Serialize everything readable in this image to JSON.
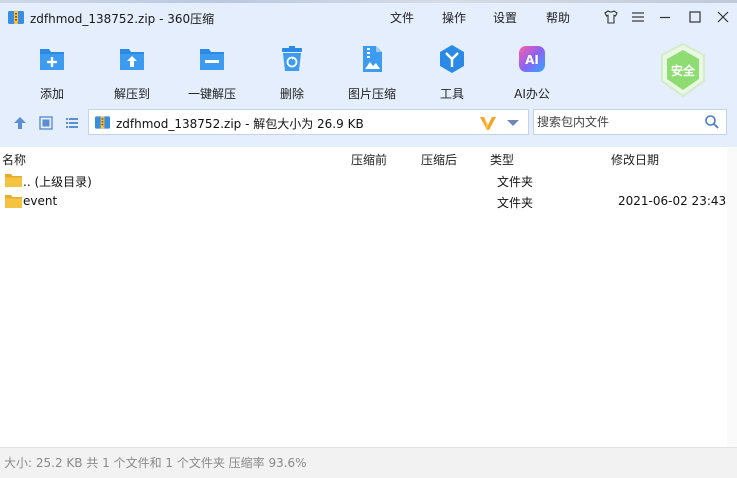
{
  "window": {
    "title": "zdfhmod_138752.zip - 360压缩",
    "menus": [
      "文件",
      "操作",
      "设置",
      "帮助"
    ]
  },
  "toolbar": {
    "items": [
      {
        "label": "添加",
        "icon": "add-icon"
      },
      {
        "label": "解压到",
        "icon": "extract-to-icon"
      },
      {
        "label": "一键解压",
        "icon": "one-click-extract-icon"
      },
      {
        "label": "删除",
        "icon": "delete-icon"
      },
      {
        "label": "图片压缩",
        "icon": "image-compress-icon"
      },
      {
        "label": "工具",
        "icon": "tools-icon"
      },
      {
        "label": "AI办公",
        "icon": "ai-office-icon"
      }
    ],
    "safe_badge": "安全",
    "ai_badge": "AI"
  },
  "address": {
    "path": "zdfhmod_138752.zip - 解包大小为 26.9 KB"
  },
  "search": {
    "placeholder": "搜索包内文件"
  },
  "columns": {
    "name": "名称",
    "compressed": "压缩前",
    "after": "压缩后",
    "type": "类型",
    "modified": "修改日期"
  },
  "files": [
    {
      "name": ".. (上级目录)",
      "type": "文件夹",
      "date": ""
    },
    {
      "name": "event",
      "type": "文件夹",
      "date": "2021-06-02 23:43"
    }
  ],
  "status": {
    "text": "大小: 25.2 KB 共 1 个文件和 1 个文件夹 压缩率 93.6%"
  },
  "colors": {
    "chrome_bg": "#e4eefc",
    "accent_blue": "#2b8ae6",
    "folder_yellow": "#f5c342"
  }
}
